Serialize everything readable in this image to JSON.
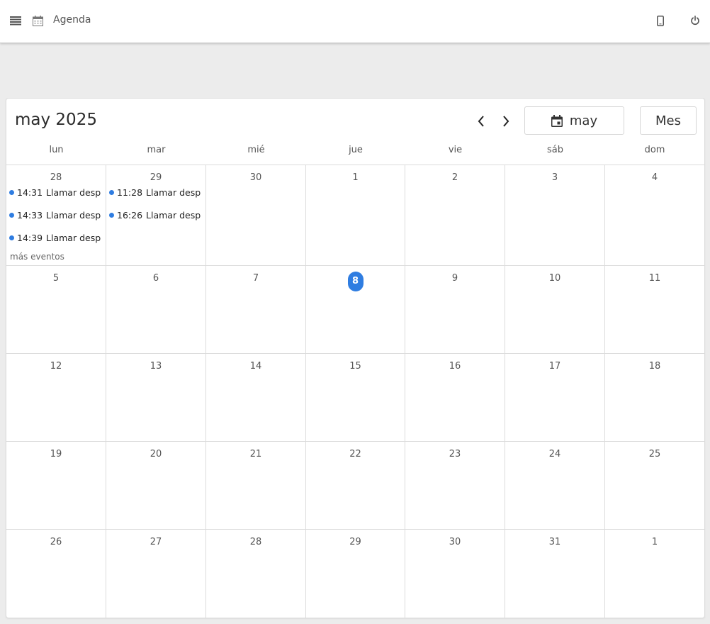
{
  "header": {
    "title": "Agenda",
    "icons": [
      "menu-icon",
      "calendar-icon",
      "mobile-phone-icon",
      "power-icon"
    ]
  },
  "calendar": {
    "title": "may 2025",
    "month_button": "may",
    "view_button": "Mes",
    "weekdays": [
      "lun",
      "mar",
      "mié",
      "jue",
      "vie",
      "sáb",
      "dom"
    ],
    "more_events": "más eventos",
    "accent_color": "#2f7de1",
    "weeks": [
      [
        {
          "num": "28",
          "events": [
            {
              "time": "14:31",
              "title": "Llamar desp"
            },
            {
              "time": "14:33",
              "title": "Llamar desp"
            },
            {
              "time": "14:39",
              "title": "Llamar desp"
            }
          ],
          "more": true
        },
        {
          "num": "29",
          "events": [
            {
              "time": "11:28",
              "title": "Llamar desp"
            },
            {
              "time": "16:26",
              "title": "Llamar desp"
            }
          ]
        },
        {
          "num": "30"
        },
        {
          "num": "1"
        },
        {
          "num": "2"
        },
        {
          "num": "3"
        },
        {
          "num": "4"
        }
      ],
      [
        {
          "num": "5"
        },
        {
          "num": "6"
        },
        {
          "num": "7"
        },
        {
          "num": "8",
          "today": true
        },
        {
          "num": "9"
        },
        {
          "num": "10"
        },
        {
          "num": "11"
        }
      ],
      [
        {
          "num": "12"
        },
        {
          "num": "13"
        },
        {
          "num": "14"
        },
        {
          "num": "15"
        },
        {
          "num": "16"
        },
        {
          "num": "17"
        },
        {
          "num": "18"
        }
      ],
      [
        {
          "num": "19"
        },
        {
          "num": "20"
        },
        {
          "num": "21"
        },
        {
          "num": "22"
        },
        {
          "num": "23"
        },
        {
          "num": "24"
        },
        {
          "num": "25"
        }
      ],
      [
        {
          "num": "26"
        },
        {
          "num": "27"
        },
        {
          "num": "28"
        },
        {
          "num": "29"
        },
        {
          "num": "30"
        },
        {
          "num": "31"
        },
        {
          "num": "1"
        }
      ]
    ]
  }
}
